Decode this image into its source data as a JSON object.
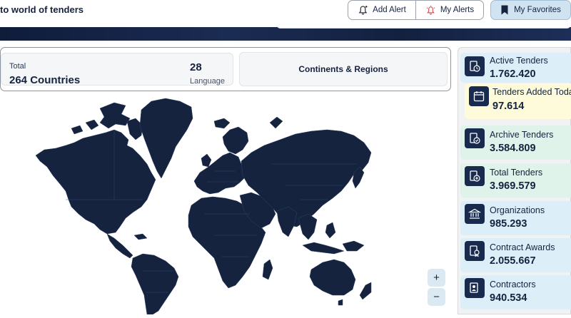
{
  "header": {
    "welcome": "to world of tenders",
    "add_alert": "Add Alert",
    "my_alerts": "My Alerts",
    "my_favorites": "My Favorites"
  },
  "summary": {
    "total_label": "Total",
    "countries": "264 Countries",
    "language_count": "28",
    "language_label": "Language",
    "continents_button": "Continents & Regions"
  },
  "map": {
    "zoom_in": "+",
    "zoom_out": "−",
    "land_color": "#15233f"
  },
  "stats": [
    {
      "label": "Active Tenders",
      "value": "1.762.420",
      "icon": "clock-document-icon",
      "bg": "#dceef8"
    },
    {
      "label": "Tenders Added Today",
      "value": "97.614",
      "icon": "calendar-icon",
      "bg": "#fdfbd9"
    },
    {
      "label": "Archive Tenders",
      "value": "3.584.809",
      "icon": "archive-document-icon",
      "bg": "#dff3ea"
    },
    {
      "label": "Total Tenders",
      "value": "3.969.579",
      "icon": "document-plus-icon",
      "bg": "#dff3ea"
    },
    {
      "label": "Organizations",
      "value": "985.293",
      "icon": "bank-icon",
      "bg": "#dceef8"
    },
    {
      "label": "Contract Awards",
      "value": "2.055.667",
      "icon": "award-document-icon",
      "bg": "#dceef8"
    },
    {
      "label": "Contractors",
      "value": "940.534",
      "icon": "contractor-document-icon",
      "bg": "#dceef8"
    }
  ]
}
